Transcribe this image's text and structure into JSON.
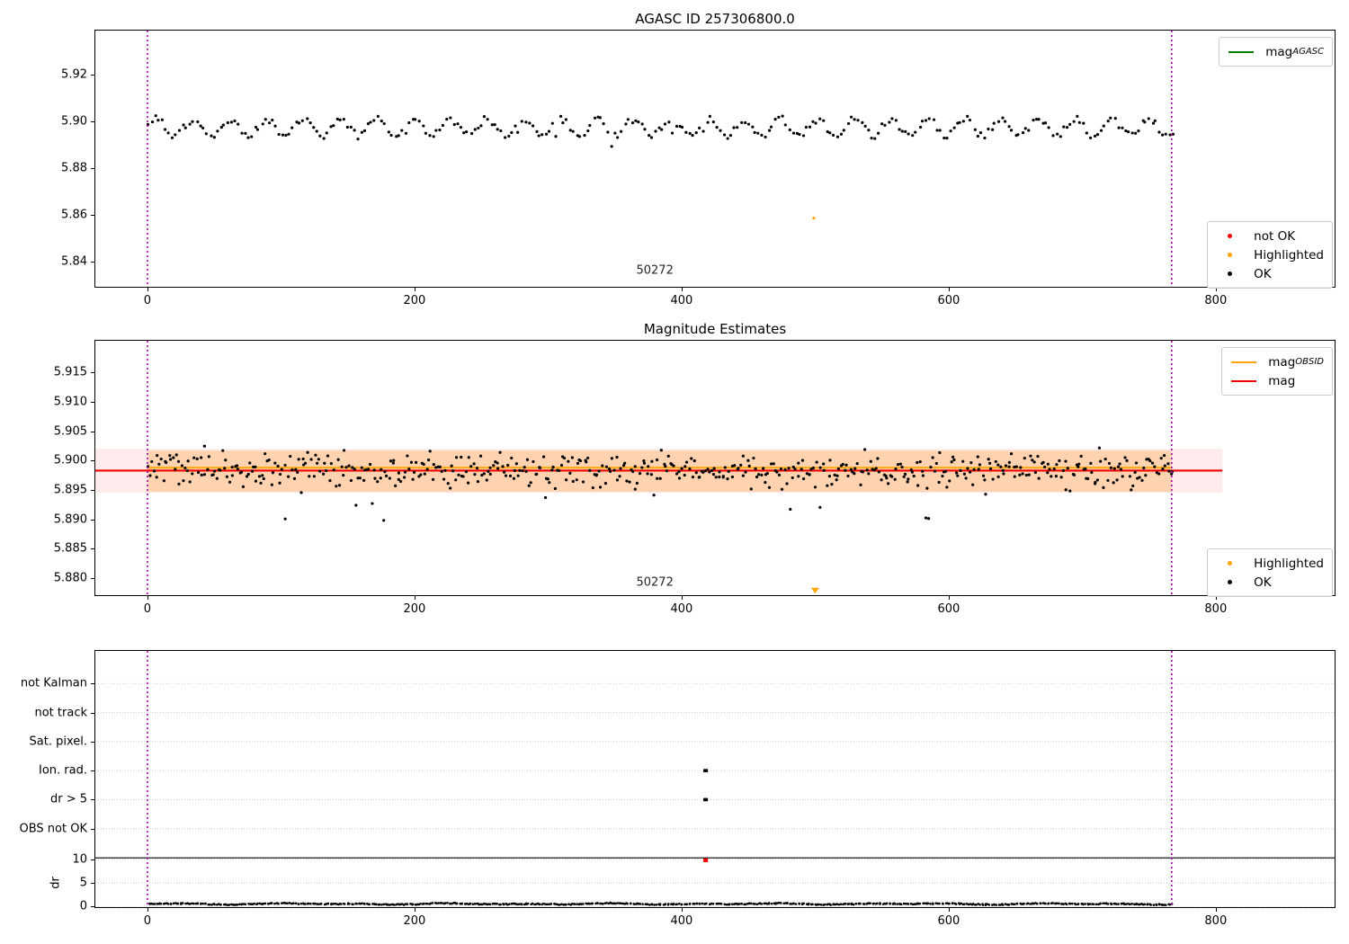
{
  "figure": {
    "background": "#ffffff"
  },
  "colors": {
    "ok_marker": "#000000",
    "not_ok_marker": "#ff0000",
    "highlighted_marker": "#ffa500",
    "mag_agasc_line": "#007d00",
    "mag_obsid_line": "#ffa500",
    "mag_line": "#ee0000",
    "obsid_vline": "#a800a8",
    "grid": "#c8c8c8",
    "pink_band": "rgba(255,0,0,0.08)",
    "orange_band": "rgba(255,140,0,0.25)"
  },
  "chart_data": [
    {
      "type": "scatter",
      "title": "AGASC ID 257306800.0",
      "xlim": [
        -39,
        889
      ],
      "ylim": [
        5.829,
        5.939
      ],
      "xticks": [
        "0",
        "200",
        "400",
        "600",
        "800"
      ],
      "yticks": [
        "5.84",
        "5.86",
        "5.88",
        "5.90",
        "5.92"
      ],
      "grid": false,
      "obsid": {
        "label": "50272",
        "x_start": 0,
        "x_end": 767,
        "label_x": 380,
        "label_y": 5.836
      },
      "vlines": [
        {
          "x": 0
        },
        {
          "x": 767
        }
      ],
      "series": [
        {
          "name": "OK",
          "color": "#000000",
          "marker": "dot",
          "generator": {
            "pattern": "wave",
            "n": 300,
            "x0": 1,
            "x1": 768,
            "base": 5.8975,
            "amp": 0.0035,
            "period": 27.5,
            "noise": 0.0016,
            "outlier_rate": 0.02,
            "outlier_drop": 0.0045,
            "seed": 101
          }
        },
        {
          "name": "Highlighted",
          "color": "#ffa500",
          "marker": "dot",
          "points": [
            [
              499,
              5.8585
            ]
          ]
        },
        {
          "name": "not OK",
          "color": "#ff0000",
          "marker": "dot",
          "points": []
        }
      ],
      "legends": [
        {
          "position": "top-right",
          "items": [
            {
              "type": "line",
              "color": "#007d00",
              "label": "mag",
              "sub": "AGASC"
            }
          ]
        },
        {
          "position": "bottom-right",
          "items": [
            {
              "type": "dot",
              "color": "#ff0000",
              "label": "not OK",
              "sub": ""
            },
            {
              "type": "dot",
              "color": "#ffa500",
              "label": "Highlighted",
              "sub": ""
            },
            {
              "type": "dot",
              "color": "#000000",
              "label": "OK",
              "sub": ""
            }
          ]
        }
      ]
    },
    {
      "type": "scatter",
      "title": "Magnitude Estimates",
      "xlim": [
        -39,
        889
      ],
      "ylim": [
        5.8771,
        5.9204
      ],
      "xticks": [
        "0",
        "200",
        "400",
        "600",
        "800"
      ],
      "yticks": [
        "5.880",
        "5.885",
        "5.890",
        "5.895",
        "5.900",
        "5.905",
        "5.910",
        "5.915"
      ],
      "grid": false,
      "obsid": {
        "label": "50272",
        "x_start": 0,
        "x_end": 767,
        "label_x": 380,
        "label_y": 5.8793
      },
      "vlines": [
        {
          "x": 0
        },
        {
          "x": 767
        }
      ],
      "bands": [
        {
          "from": 5.8945,
          "to": 5.902,
          "x_from": -39,
          "x_to": 805,
          "color": "rgba(255,0,0,0.08)",
          "name": "mag-uncertainty-band"
        },
        {
          "from": 5.8947,
          "to": 5.9017,
          "x_from": 0,
          "x_to": 767,
          "color": "rgba(255,140,0,0.25)",
          "name": "obsid-band"
        }
      ],
      "hlines": [
        {
          "value": 5.8988,
          "x_from": 0,
          "x_to": 767,
          "color": "#ffa500",
          "width": 1.8,
          "name": "mag_OBSID"
        },
        {
          "value": 5.8983,
          "x_from": -39,
          "x_to": 805,
          "color": "#ee0000",
          "width": 2.2,
          "name": "mag"
        }
      ],
      "series": [
        {
          "name": "OK",
          "color": "#000000",
          "marker": "dot",
          "generator": {
            "pattern": "noise",
            "n": 560,
            "x0": 1,
            "x1": 768,
            "base": 5.8985,
            "spread": 0.0042,
            "outlier_rate": 0.035,
            "outlier_drop": 0.0055,
            "seed": 202
          }
        },
        {
          "name": "Highlighted",
          "color": "#ffa500",
          "marker": "triangle-down",
          "points": [
            [
              500,
              5.8779
            ]
          ]
        }
      ],
      "legends": [
        {
          "position": "top-right",
          "items": [
            {
              "type": "line",
              "color": "#ffa500",
              "label": "mag",
              "sub": "OBSID"
            },
            {
              "type": "line",
              "color": "#ee0000",
              "label": "mag",
              "sub": ""
            }
          ]
        },
        {
          "position": "bottom-right",
          "items": [
            {
              "type": "dot",
              "color": "#ffa500",
              "label": "Highlighted",
              "sub": ""
            },
            {
              "type": "dot",
              "color": "#000000",
              "label": "OK",
              "sub": ""
            }
          ]
        }
      ]
    },
    {
      "type": "scatter",
      "title": "",
      "xlim": [
        -39,
        889
      ],
      "xticks": [
        "0",
        "200",
        "400",
        "600",
        "800"
      ],
      "flag_rows": [
        "not Kalman",
        "not track",
        "Sat. pixel.",
        "Ion. rad.",
        "dr > 5",
        "OBS not OK"
      ],
      "dr_axis_label": "dr",
      "dr_ticks": [
        "10",
        "5",
        "0"
      ],
      "dr_threshold": 10,
      "grid": true,
      "vlines": [
        {
          "x": 0
        },
        {
          "x": 767
        }
      ],
      "flag_points": [
        {
          "row": "Ion. rad.",
          "x": 418,
          "color": "#000000"
        },
        {
          "row": "dr > 5",
          "x": 418,
          "color": "#000000"
        }
      ],
      "dr_points": [
        {
          "x": 418,
          "dr": 10,
          "color": "#ff0000",
          "name": "not-ok-dr-point"
        }
      ],
      "series": [
        {
          "name": "dr",
          "color": "#000000",
          "marker": "dot",
          "generator": {
            "pattern": "dr",
            "n": 620,
            "x0": 1,
            "x1": 767,
            "base": 0.55,
            "wobble": 0.15,
            "noise": 0.22,
            "seed": 303
          }
        }
      ]
    }
  ]
}
